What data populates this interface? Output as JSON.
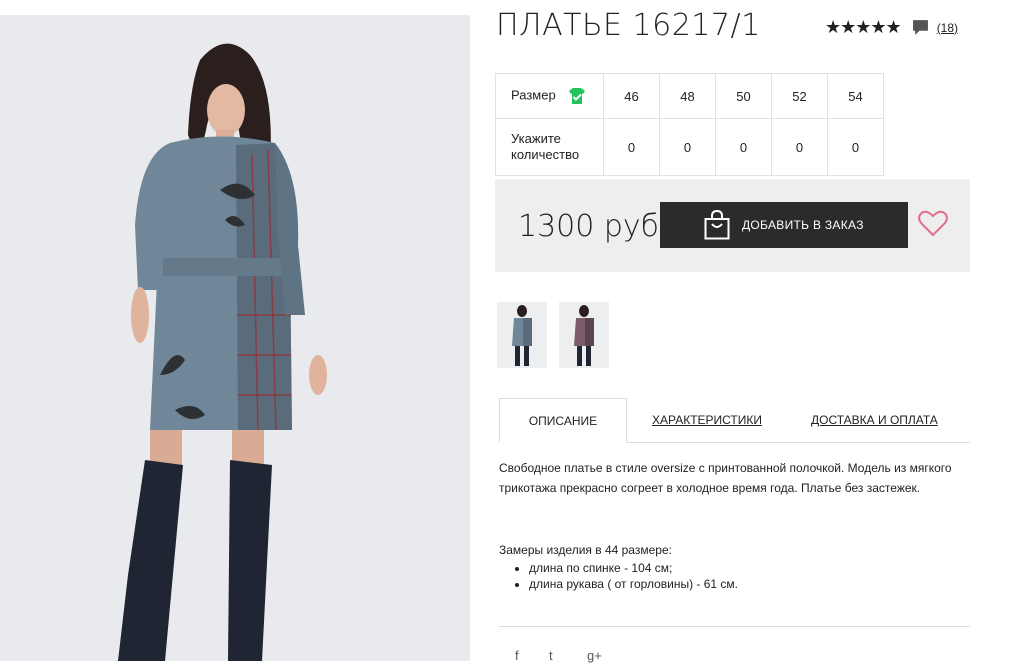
{
  "product": {
    "title": "ПЛАТЬЕ 16217/1",
    "rating": {
      "stars": "★★★★★",
      "count": "(18)"
    },
    "price": "1300 руб"
  },
  "sizes": {
    "label": "Размер",
    "qty_label": "Укажите количество",
    "items": [
      {
        "size": "46",
        "qty": "0"
      },
      {
        "size": "48",
        "qty": "0"
      },
      {
        "size": "50",
        "qty": "0"
      },
      {
        "size": "52",
        "qty": "0"
      },
      {
        "size": "54",
        "qty": "0"
      }
    ]
  },
  "actions": {
    "add_to_order": "ДОБАВИТЬ В ЗАКАЗ"
  },
  "tabs": [
    {
      "label": "ОПИСАНИЕ",
      "active": true
    },
    {
      "label": "ХАРАКТЕРИСТИКИ",
      "active": false
    },
    {
      "label": "ДОСТАВКА И ОПЛАТА",
      "active": false
    }
  ],
  "description": {
    "text": "Свободное платье в стиле oversize с принтованной полочкой. Модель из мягкого трикотажа прекрасно согреет в холодное время года. Платье без застежек.",
    "measure_title": "Замеры изделия в 44 размере:",
    "measures": [
      "длина по спинке - 104 см;",
      "длина рукава ( от горловины) - 61 см."
    ]
  },
  "social": {
    "facebook": "f",
    "twitter": "t",
    "gplus": "g+"
  },
  "colors": {
    "accent_green": "#21c35c",
    "heart": "#e26d8a",
    "button": "#2b2b2b"
  }
}
